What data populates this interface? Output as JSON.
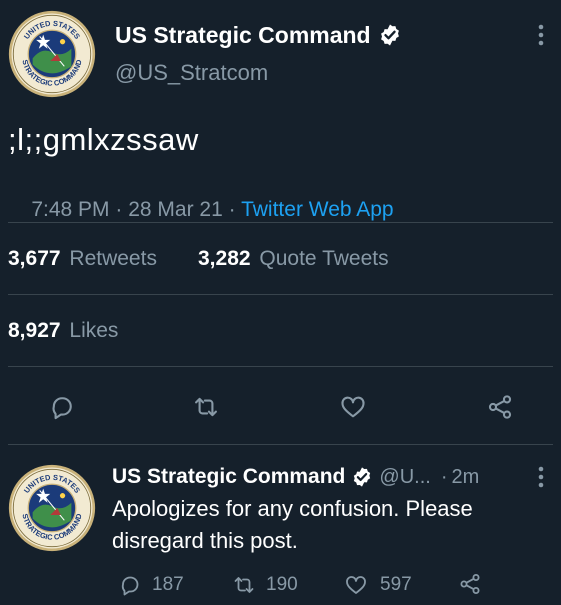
{
  "tweet": {
    "author_name": "US Strategic Command",
    "author_handle": "@US_Stratcom",
    "text": ";l;;gmlxzssaw",
    "time": "7:48 PM",
    "date_sep": " · ",
    "date": "28 Mar 21",
    "source_sep": " · ",
    "source": "Twitter Web App",
    "retweets_count": "3,677",
    "retweets_label": "Retweets",
    "quotes_count": "3,282",
    "quotes_label": "Quote Tweets",
    "likes_count": "8,927",
    "likes_label": "Likes",
    "avatar_seal_text": "UNITED STATES STRATEGIC COMMAND"
  },
  "reply": {
    "author_name": "US Strategic Command",
    "author_handle": "@U...",
    "time_sep": "·",
    "time": "2m",
    "text_line1": "Apologizes for any confusion. Please",
    "text_line2": "disregard this post.",
    "replies": "187",
    "retweets": "190",
    "likes": "597",
    "avatar_seal_text": "UNITED STATES STRATEGIC COMMAND"
  },
  "icons": {
    "more": "more-vertical-icon",
    "reply": "reply-icon",
    "retweet": "retweet-icon",
    "like": "heart-icon",
    "share": "share-icon",
    "verified": "verified-badge-icon"
  },
  "colors": {
    "background": "#15202b",
    "text": "#ffffff",
    "muted": "#8899a6",
    "link": "#1da1f2",
    "divider": "#38444d"
  }
}
